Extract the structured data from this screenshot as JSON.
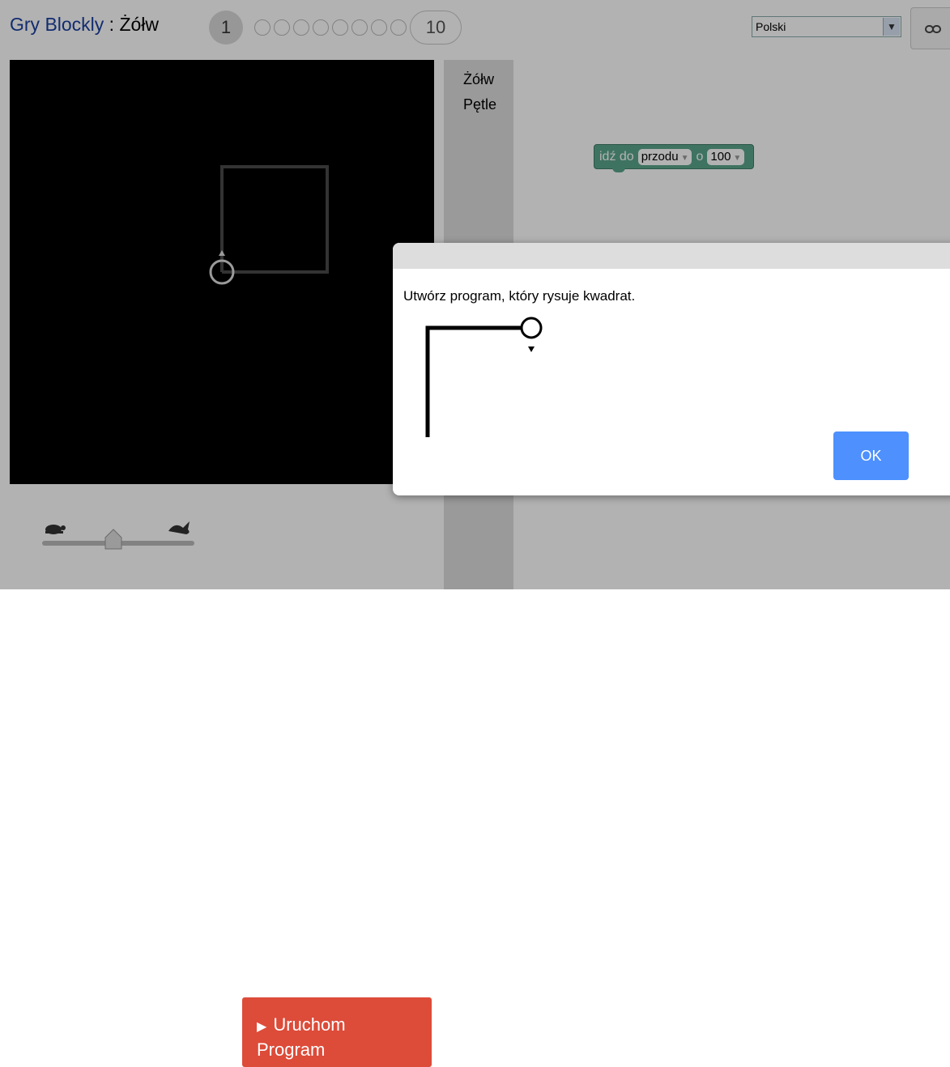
{
  "header": {
    "app_name": "Gry Blockly",
    "separator": " : ",
    "game_name": "Żółw",
    "level_current": "1",
    "level_last": "10",
    "language": "Polski",
    "link_icon": "link-icon"
  },
  "toolbox": {
    "categories": [
      "Żółw",
      "Pętle"
    ]
  },
  "workspace": {
    "block": {
      "text_before": "idź do",
      "direction": "przodu",
      "text_mid": "o",
      "amount": "100"
    }
  },
  "controls": {
    "slow_icon": "turtle-icon",
    "fast_icon": "rabbit-icon",
    "run_label_line1": "Uruchom",
    "run_label_line2": "Program",
    "run_icon": "play-icon"
  },
  "dialog": {
    "message": "Utwórz program, który rysuje kwadrat.",
    "ok_label": "OK"
  },
  "colors": {
    "run_button": "#dd4b39",
    "ok_button": "#4d90fe",
    "block": "#5ba58c",
    "title_blue": "#1a3fa0"
  }
}
